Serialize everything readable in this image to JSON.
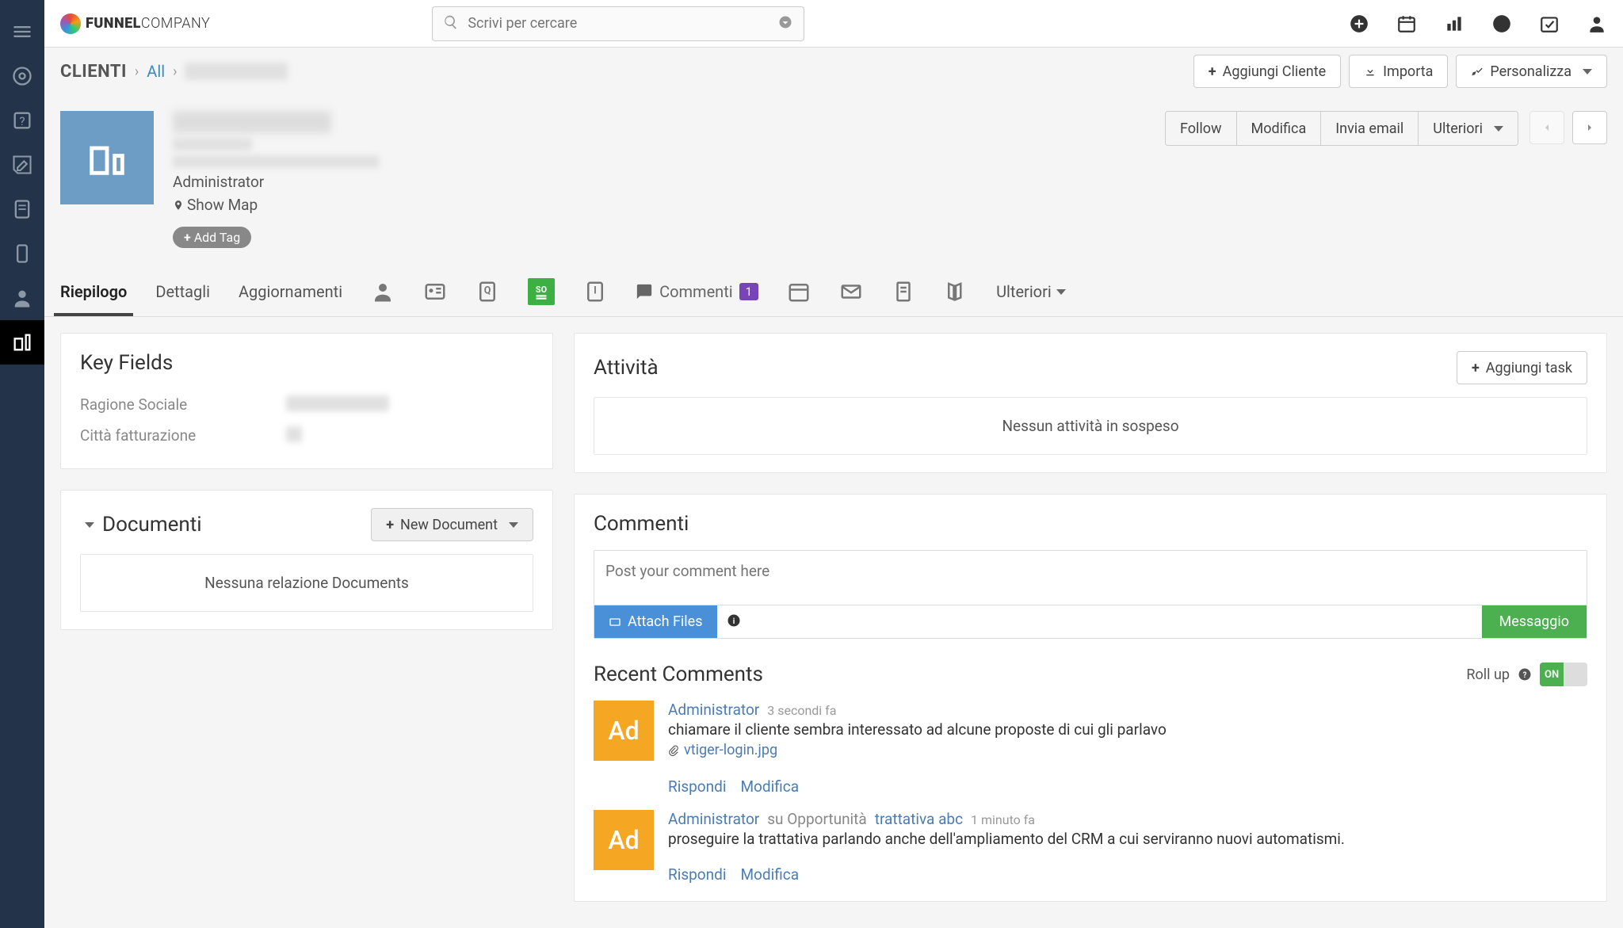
{
  "brand": {
    "name_bold": "FUNNEL",
    "name_light": "COMPANY"
  },
  "search": {
    "placeholder": "Scrivi per cercare"
  },
  "breadcrumb": {
    "module": "CLIENTI",
    "all": "All"
  },
  "header_buttons": {
    "add_client": "Aggiungi Cliente",
    "import": "Importa",
    "customize": "Personalizza"
  },
  "record": {
    "role": "Administrator",
    "show_map": "Show Map",
    "add_tag": "Add Tag"
  },
  "record_actions": {
    "follow": "Follow",
    "edit": "Modifica",
    "send_email": "Invia email",
    "more": "Ulteriori"
  },
  "tabs": {
    "riepilogo": "Riepilogo",
    "dettagli": "Dettagli",
    "aggiornamenti": "Aggiornamenti",
    "commenti": "Commenti",
    "commenti_count": "1",
    "ulteriori": "Ulteriori"
  },
  "key_fields": {
    "title": "Key Fields",
    "ragione_sociale_label": "Ragione Sociale",
    "citta_label": "Città fatturazione"
  },
  "documenti": {
    "title": "Documenti",
    "new_doc": "New Document",
    "empty": "Nessuna relazione Documents"
  },
  "attivita": {
    "title": "Attività",
    "add_task": "Aggiungi task",
    "empty": "Nessun attività in sospeso"
  },
  "commenti": {
    "title": "Commenti",
    "placeholder": "Post your comment here",
    "attach": "Attach Files",
    "send": "Messaggio"
  },
  "recent": {
    "title": "Recent Comments",
    "rollup_label": "Roll up",
    "toggle": "ON",
    "items": [
      {
        "avatar": "Ad",
        "author": "Administrator",
        "time": "3 secondi fa",
        "text": "chiamare il cliente sembra interessato ad alcune proposte di cui gli parlavo",
        "attachment": "vtiger-login.jpg",
        "reply": "Rispondi",
        "edit": "Modifica"
      },
      {
        "avatar": "Ad",
        "author": "Administrator",
        "context": "su Opportunità",
        "relation": "trattativa abc",
        "time": "1 minuto fa",
        "text": "proseguire la trattativa parlando anche dell'ampliamento del CRM a cui serviranno nuovi automatismi.",
        "reply": "Rispondi",
        "edit": "Modifica"
      }
    ]
  }
}
